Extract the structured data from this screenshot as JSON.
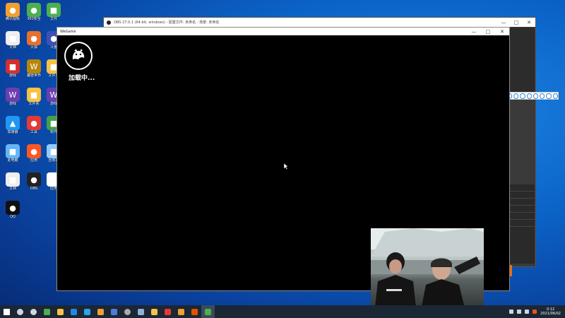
{
  "desktop": {
    "icons": [
      {
        "name": "icon-1",
        "label": "腾讯视频",
        "color": "#f0a030",
        "glyph": "●"
      },
      {
        "name": "icon-2",
        "label": "360安全",
        "color": "#4caf50",
        "glyph": "●"
      },
      {
        "name": "icon-3",
        "label": "文件",
        "color": "#4caf50",
        "glyph": "■"
      },
      {
        "name": "icon-4",
        "label": "文档",
        "color": "#eeeeee",
        "glyph": "■"
      },
      {
        "name": "icon-5",
        "label": "火狐",
        "color": "#e8702a",
        "glyph": "●"
      },
      {
        "name": "icon-6",
        "label": "斗鱼",
        "color": "#3f51b5",
        "glyph": "●"
      },
      {
        "name": "icon-7",
        "label": "游戏",
        "color": "#d32f2f",
        "glyph": "■"
      },
      {
        "name": "icon-8",
        "label": "魔兽世界",
        "color": "#b8860b",
        "glyph": "W"
      },
      {
        "name": "icon-9",
        "label": "文件夹",
        "color": "#f6c244",
        "glyph": "■"
      },
      {
        "name": "icon-10",
        "label": "游戏",
        "color": "#6a3fb0",
        "glyph": "W"
      },
      {
        "name": "icon-11",
        "label": "文件夹",
        "color": "#f6c244",
        "glyph": "■"
      },
      {
        "name": "icon-12",
        "label": "游戏",
        "color": "#6a3fb0",
        "glyph": "W"
      },
      {
        "name": "icon-13",
        "label": "加速器",
        "color": "#2196f3",
        "glyph": "▲"
      },
      {
        "name": "icon-14",
        "label": "工具",
        "color": "#e53935",
        "glyph": "●"
      },
      {
        "name": "icon-15",
        "label": "软件",
        "color": "#43a047",
        "glyph": "■"
      },
      {
        "name": "icon-16",
        "label": "此电脑",
        "color": "#64b5f6",
        "glyph": "■"
      },
      {
        "name": "icon-17",
        "label": "应用",
        "color": "#ff5722",
        "glyph": "●"
      },
      {
        "name": "icon-18",
        "label": "回收站",
        "color": "#90caf9",
        "glyph": "■"
      },
      {
        "name": "icon-19",
        "label": "文档",
        "color": "#eeeeee",
        "glyph": "■"
      },
      {
        "name": "icon-20",
        "label": "OBS",
        "color": "#222222",
        "glyph": "●"
      },
      {
        "name": "icon-21",
        "label": "应用",
        "color": "#ffffff",
        "glyph": "■"
      },
      {
        "name": "icon-22",
        "label": "QQ",
        "color": "#111111",
        "glyph": "●"
      }
    ]
  },
  "obs": {
    "title": "OBS 27.0.1 (64-bit, windows) - 配置文件: 未命名 - 场景: 未命名",
    "controls": [
      "—",
      "□",
      "✕"
    ]
  },
  "game": {
    "title": "WeGame",
    "controls": [
      "—",
      "□",
      "✕"
    ],
    "loading": "加载中..."
  },
  "taskbar": {
    "items": [
      {
        "name": "start",
        "color": "#ffffff"
      },
      {
        "name": "search",
        "color": "#cfd6de"
      },
      {
        "name": "taskview",
        "color": "#cfd6de"
      },
      {
        "name": "app-1",
        "color": "#4caf50"
      },
      {
        "name": "explorer",
        "color": "#f6c244"
      },
      {
        "name": "app-2",
        "color": "#1e88e5"
      },
      {
        "name": "edge",
        "color": "#2aa3f0"
      },
      {
        "name": "app-3",
        "color": "#f0a030"
      },
      {
        "name": "app-4",
        "color": "#4a7fd8"
      },
      {
        "name": "obs",
        "color": "#aaaaaa"
      },
      {
        "name": "steam",
        "color": "#8fb2d8"
      },
      {
        "name": "app-5",
        "color": "#f6c244"
      },
      {
        "name": "app-6",
        "color": "#e53935"
      },
      {
        "name": "app-7",
        "color": "#f0a030"
      },
      {
        "name": "app-8",
        "color": "#e65100"
      },
      {
        "name": "app-9",
        "color": "#4caf50"
      }
    ],
    "time": "0:12",
    "date": "2021/06/02"
  }
}
